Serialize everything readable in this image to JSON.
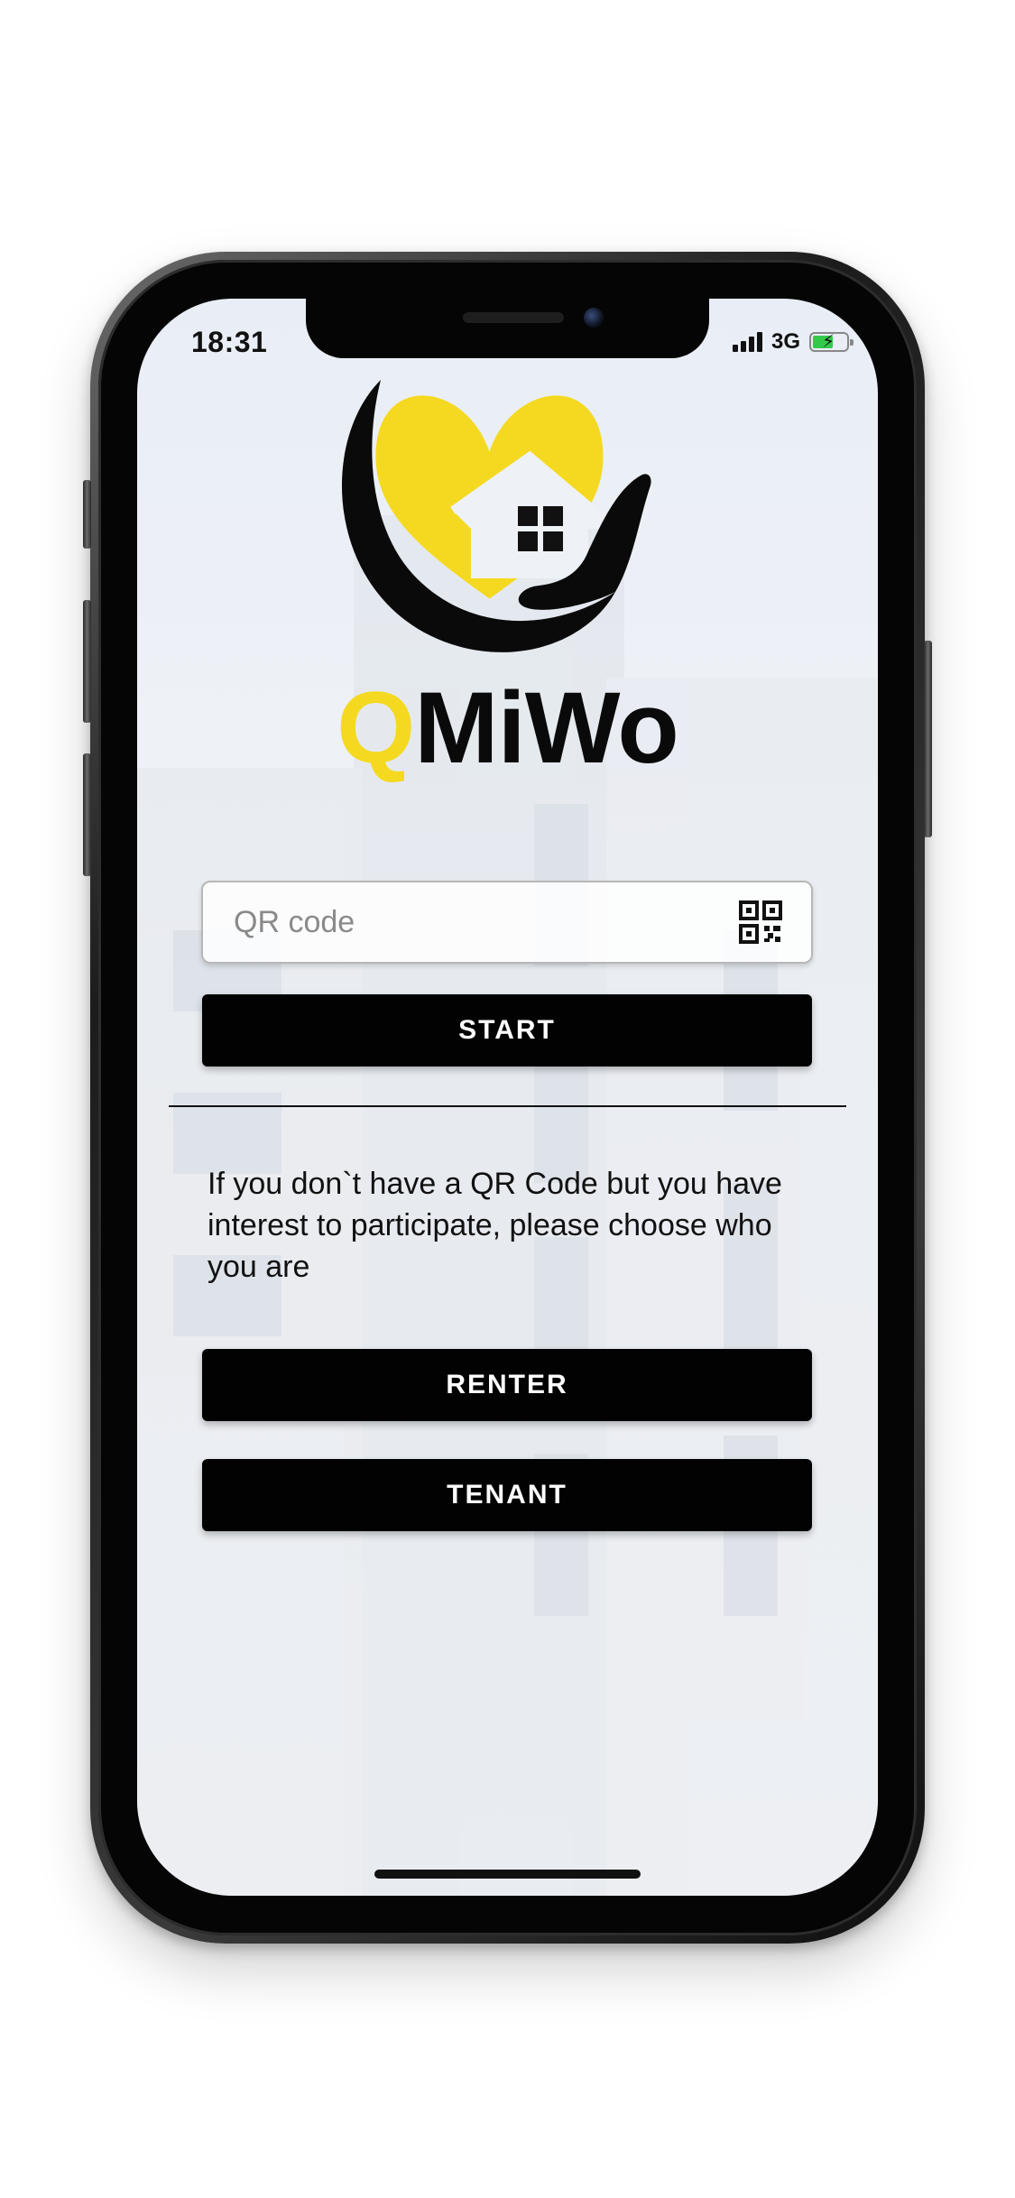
{
  "status_bar": {
    "time": "18:31",
    "network": "3G",
    "battery_level": 0.6,
    "battery_charging": true,
    "signal_bars": 4
  },
  "brand": {
    "name_first_letter": "Q",
    "name_rest": "MiWo",
    "accent_color": "#f5d920",
    "text_color": "#0a0a0a"
  },
  "qr_input": {
    "placeholder": "QR code",
    "value": "",
    "icon": "qr-code-icon"
  },
  "start_button": {
    "label": "START"
  },
  "info_text": "If you don`t have a QR Code but you have interest to participate, please choose who you are",
  "role_buttons": {
    "renter_label": "RENTER",
    "tenant_label": "TENANT"
  },
  "colors": {
    "button_bg": "#020202",
    "button_text": "#ffffff",
    "battery_fill": "#33c94a"
  }
}
